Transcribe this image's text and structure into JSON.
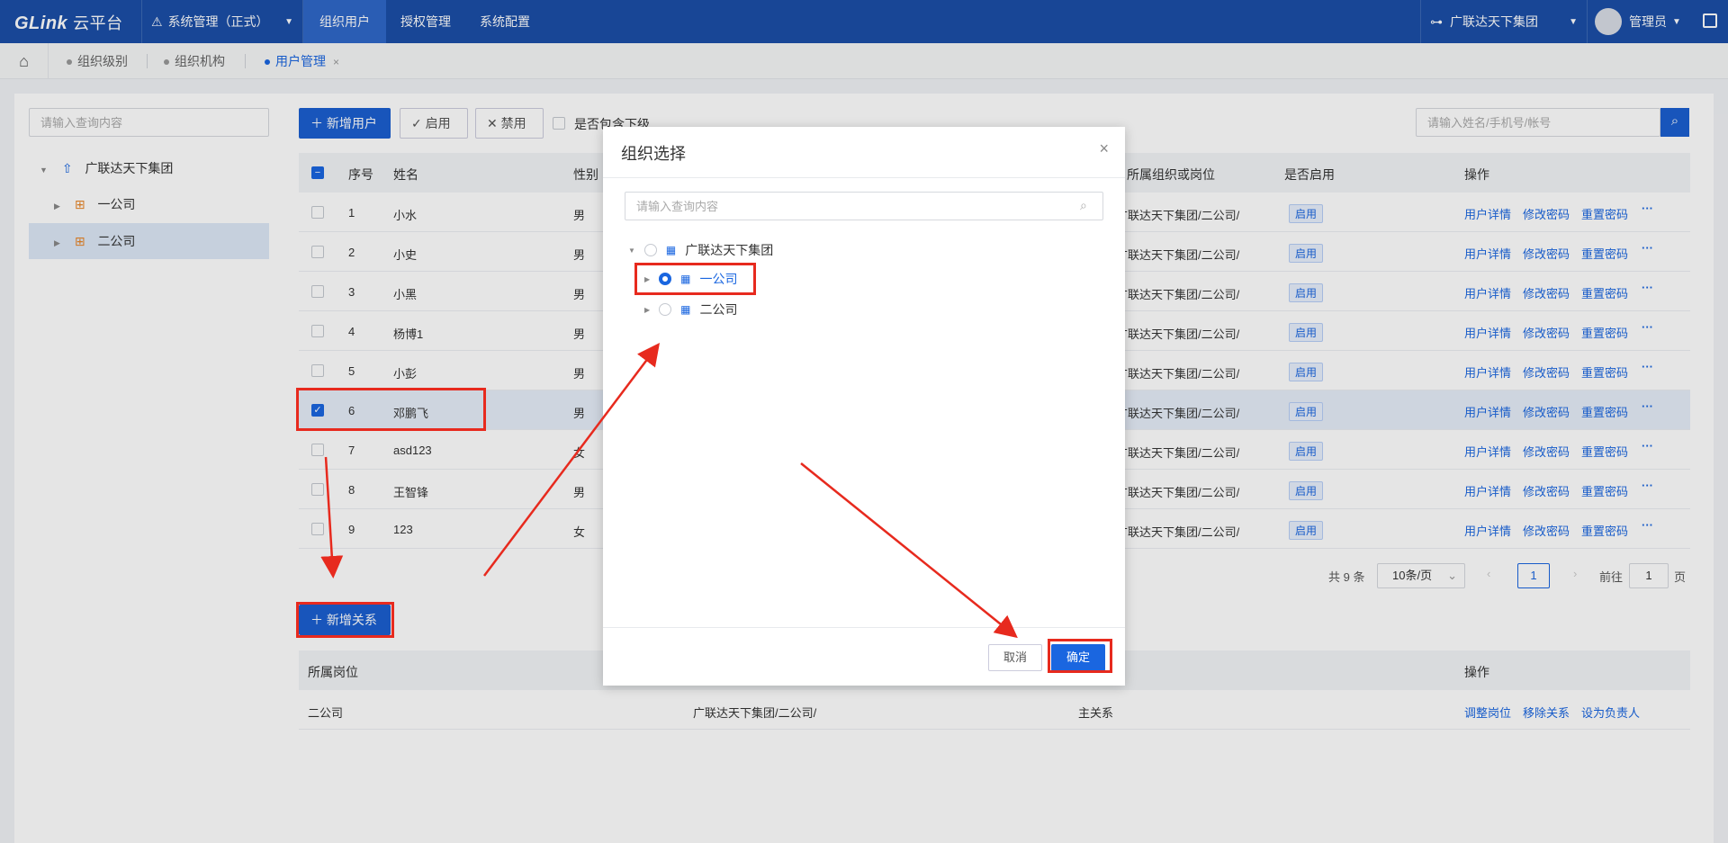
{
  "topbar": {
    "logo": "GLink",
    "logo_cn": "云平台",
    "system_menu": "系统管理（正式）",
    "nav": [
      "组织用户",
      "授权管理",
      "系统配置"
    ],
    "org": "广联达天下集团",
    "user": "管理员"
  },
  "tabs": [
    "组织级别",
    "组织机构",
    "用户管理"
  ],
  "left": {
    "search_placeholder": "请输入查询内容",
    "tree": {
      "root": "广联达天下集团",
      "children": [
        "一公司",
        "二公司"
      ]
    }
  },
  "toolbar": {
    "add_user": "新增用户",
    "enable": "启用",
    "disable": "禁用",
    "include_sub": "是否包含下级",
    "search_placeholder": "请输入姓名/手机号/帐号"
  },
  "table": {
    "headers": {
      "seq": "序号",
      "name": "姓名",
      "gender": "性别",
      "org": "所属组织或岗位",
      "enabled": "是否启用",
      "actions": "操作"
    },
    "rows": [
      {
        "seq": "1",
        "name": "小水",
        "gender": "男",
        "org": "广联达天下集团/二公司/",
        "status": "启用"
      },
      {
        "seq": "2",
        "name": "小史",
        "gender": "男",
        "org": "广联达天下集团/二公司/",
        "status": "启用"
      },
      {
        "seq": "3",
        "name": "小黑",
        "gender": "男",
        "org": "广联达天下集团/二公司/",
        "status": "启用"
      },
      {
        "seq": "4",
        "name": "杨博1",
        "gender": "男",
        "org": "广联达天下集团/二公司/",
        "status": "启用"
      },
      {
        "seq": "5",
        "name": "小彭",
        "gender": "男",
        "org": "广联达天下集团/二公司/",
        "status": "启用"
      },
      {
        "seq": "6",
        "name": "邓鹏飞",
        "gender": "男",
        "org": "广联达天下集团/二公司/",
        "status": "启用"
      },
      {
        "seq": "7",
        "name": "asd123",
        "gender": "女",
        "org": "广联达天下集团/二公司/",
        "status": "启用"
      },
      {
        "seq": "8",
        "name": "王智锋",
        "gender": "男",
        "org": "广联达天下集团/二公司/",
        "status": "启用"
      },
      {
        "seq": "9",
        "name": "123",
        "gender": "女",
        "org": "广联达天下集团/二公司/",
        "status": "启用"
      }
    ],
    "row_actions": {
      "detail": "用户详情",
      "change_pwd": "修改密码",
      "reset_pwd": "重置密码",
      "more": "···"
    }
  },
  "pagination": {
    "total": "共 9 条",
    "page_size": "10条/页",
    "current": "1",
    "goto_label": "前往",
    "goto_value": "1",
    "page_suffix": "页"
  },
  "relation": {
    "add_button": "新增关系",
    "headers": {
      "position": "所属岗位",
      "action": "操作"
    },
    "row": {
      "position": "二公司",
      "path": "广联达天下集团/二公司/",
      "type": "主关系"
    },
    "actions": {
      "adjust": "调整岗位",
      "remove": "移除关系",
      "set_leader": "设为负责人"
    }
  },
  "modal": {
    "title": "组织选择",
    "search_placeholder": "请输入查询内容",
    "tree": {
      "root": "广联达天下集团",
      "child1": "一公司",
      "child2": "二公司"
    },
    "cancel": "取消",
    "confirm": "确定"
  },
  "colors": {
    "brand": "#1b4fa8",
    "primary": "#1a66e0",
    "annotation": "#e72a1e"
  }
}
